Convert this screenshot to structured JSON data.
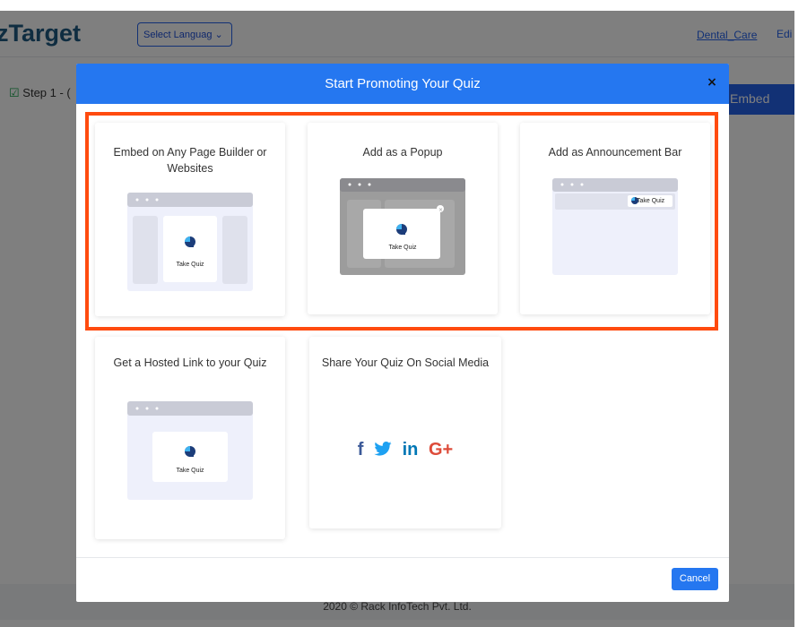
{
  "background": {
    "brand": "zTarget",
    "language_select": "Select Languag ⌄",
    "top_link": "Dental_Care",
    "top_edit": "Edi",
    "step_label": "Step 1 - (",
    "embed_tab": "Embed",
    "footer_text": "2020 © Rack InfoTech Pvt. Ltd."
  },
  "modal": {
    "title": "Start Promoting Your Quiz",
    "close_icon": "×",
    "cancel_label": "Cancel",
    "highlight_color": "#ff4b0f",
    "header_color": "#2577f0",
    "options": [
      {
        "title": "Embed on Any Page Builder or Websites",
        "button_text": "Take Quiz"
      },
      {
        "title": "Add as a Popup",
        "button_text": "Take Quiz"
      },
      {
        "title": "Add as Announcement Bar",
        "button_text": "Take Quiz"
      },
      {
        "title": "Get a Hosted Link to your Quiz",
        "button_text": "Take Quiz"
      },
      {
        "title": "Share Your Quiz On Social Media"
      }
    ],
    "social": {
      "facebook": "f",
      "twitter": "🐦",
      "linkedin": "in",
      "google_plus": "G+"
    }
  }
}
